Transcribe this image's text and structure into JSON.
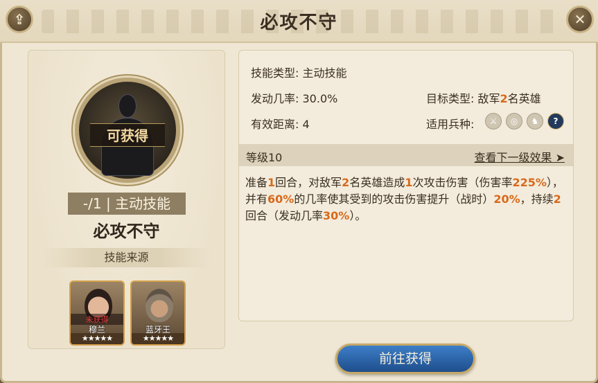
{
  "title": "必攻不守",
  "left": {
    "orb_label": "可获得",
    "type_strip": "-/1 | 主动技能",
    "skill_name": "必攻不守",
    "source_label": "技能来源",
    "heroes": [
      {
        "status": "未获得",
        "name": "穆兰",
        "stars": "★★★★★"
      },
      {
        "status": "",
        "name": "蓝牙王",
        "stars": "★★★★★"
      }
    ]
  },
  "stats": {
    "skill_type_k": "技能类型:",
    "skill_type_v": "主动技能",
    "rate_k": "发动几率:",
    "rate_v": "30.0%",
    "target_k": "目标类型:",
    "target_v_prefix": "敌军",
    "target_v_num": "2",
    "target_v_suffix": "名英雄",
    "range_k": "有效距离:",
    "range_v": "4",
    "troop_k": "适用兵种:"
  },
  "troop_icons": [
    "sword-icon",
    "target-icon",
    "horse-icon",
    "question-icon"
  ],
  "level": {
    "label": "等级10",
    "next": "查看下一级效果 ➤"
  },
  "desc": {
    "p1": "准备",
    "n1": "1",
    "p2": "回合，对敌军",
    "n2": "2",
    "p3": "名英雄造成",
    "n3": "1",
    "p4": "次攻击伤害（伤害率",
    "n4": "225%",
    "p5": "），并有",
    "n5": "60%",
    "p6": "的几率使其受到的攻击伤害提升（战时）",
    "n6": "20%",
    "p7": "，持续",
    "n7": "2",
    "p8": "回合（发动几率",
    "n8": "30%",
    "p9": "）。"
  },
  "button": "前往获得",
  "colors": {
    "highlight": "#d8691b",
    "button": "#2a63a8"
  }
}
